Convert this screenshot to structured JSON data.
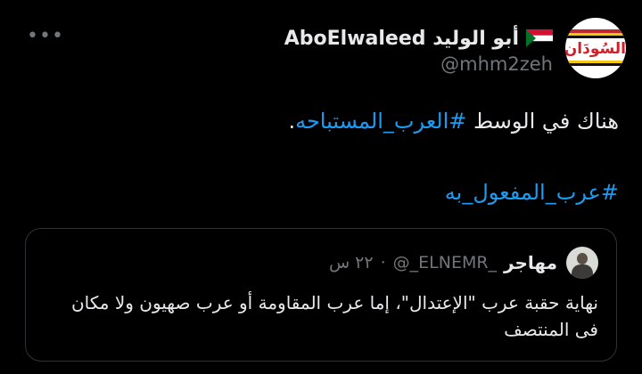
{
  "author": {
    "display_name": "AboElwaleed أبو الوليد",
    "handle": "@mhm2zeh",
    "avatar_text": "السُودَان",
    "flag_icon": "sudan-flag-icon"
  },
  "more_icon": "more-options-icon",
  "tweet": {
    "line1_text": "هناك في الوسط ",
    "line1_hashtag": "#العرب_المستباحه",
    "line1_end": ".",
    "line2_hashtag": "#عرب_المفعول_به"
  },
  "quoted": {
    "name": "مهاجر",
    "handle": "@_ELNEMR_",
    "separator": "·",
    "time": "٢٢ س",
    "text": "نهاية حقبة عرب \"الإعتدال\"، إما عرب المقاومة أو عرب صهيون ولا مكان فى المنتصف"
  },
  "colors": {
    "background": "#000000",
    "text": "#e7e9ea",
    "secondary": "#71767b",
    "link": "#1d9bf0",
    "border": "#2f3336"
  }
}
